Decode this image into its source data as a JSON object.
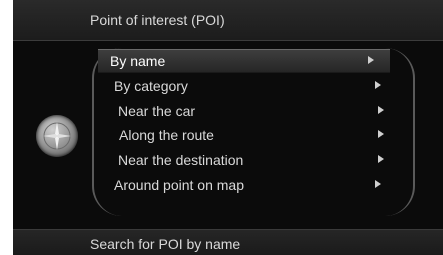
{
  "header": {
    "title": "Point of interest (POI)"
  },
  "menu": {
    "items": [
      {
        "label": "By name",
        "selected": true,
        "icon": "arrow-right-icon"
      },
      {
        "label": "By category",
        "selected": false,
        "icon": "arrow-right-icon"
      },
      {
        "label": "Near the car",
        "selected": false,
        "icon": "arrow-right-icon"
      },
      {
        "label": "Along the route",
        "selected": false,
        "icon": "arrow-right-icon"
      },
      {
        "label": "Near the destination",
        "selected": false,
        "icon": "arrow-right-icon"
      },
      {
        "label": "Around point on map",
        "selected": false,
        "icon": "arrow-right-icon"
      }
    ]
  },
  "footer": {
    "text": "Search for POI by name"
  },
  "icons": {
    "compass": "compass-icon"
  },
  "colors": {
    "background": "#0b0b0b",
    "text": "#d9d9d9",
    "selected_bg": "#3e3e3e"
  }
}
